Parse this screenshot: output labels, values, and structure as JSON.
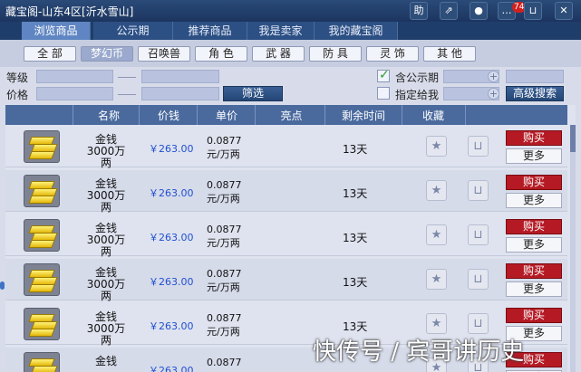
{
  "window": {
    "title": "藏宝阁-山东4区[沂水雪山]"
  },
  "toolbar": {
    "help_label": "助",
    "notification_count": "74"
  },
  "tabs": [
    {
      "label": "浏览商品"
    },
    {
      "label": "公示期"
    },
    {
      "label": "推荐商品"
    },
    {
      "label": "我是卖家"
    },
    {
      "label": "我的藏宝阁"
    }
  ],
  "categories": [
    {
      "label": "全 部"
    },
    {
      "label": "梦幻币"
    },
    {
      "label": "召唤兽"
    },
    {
      "label": "角 色"
    },
    {
      "label": "武 器"
    },
    {
      "label": "防 具"
    },
    {
      "label": "灵 饰"
    },
    {
      "label": "其 他"
    }
  ],
  "filters": {
    "level_label": "等级",
    "price_label": "价格",
    "filter_button": "筛选",
    "include_public_label": "含公示期",
    "assigned_to_me_label": "指定给我",
    "advanced_search_button": "高级搜索",
    "include_public_checked": true,
    "assigned_to_me_checked": false
  },
  "table": {
    "headers": [
      "名称",
      "价钱",
      "单价",
      "亮点",
      "剩余时间",
      "收藏"
    ],
    "buy_label": "购买",
    "more_label": "更多",
    "rows": [
      {
        "name": "金钱",
        "amount": "3000万两",
        "price": "￥263.00",
        "unit_price": "0.0877",
        "unit_suffix": "元/万两",
        "time": "13天"
      },
      {
        "name": "金钱",
        "amount": "3000万两",
        "price": "￥263.00",
        "unit_price": "0.0877",
        "unit_suffix": "元/万两",
        "time": "13天"
      },
      {
        "name": "金钱",
        "amount": "3000万两",
        "price": "￥263.00",
        "unit_price": "0.0877",
        "unit_suffix": "元/万两",
        "time": "13天"
      },
      {
        "name": "金钱",
        "amount": "3000万两",
        "price": "￥263.00",
        "unit_price": "0.0877",
        "unit_suffix": "元/万两",
        "time": "13天"
      },
      {
        "name": "金钱",
        "amount": "3000万两",
        "price": "￥263.00",
        "unit_price": "0.0877",
        "unit_suffix": "元/万两",
        "time": "13天"
      },
      {
        "name": "金钱",
        "amount": "",
        "price": "￥263.00",
        "unit_price": "0.0877",
        "unit_suffix": "",
        "time": ""
      }
    ]
  },
  "watermark": "快传号 / 宾哥讲历史"
}
